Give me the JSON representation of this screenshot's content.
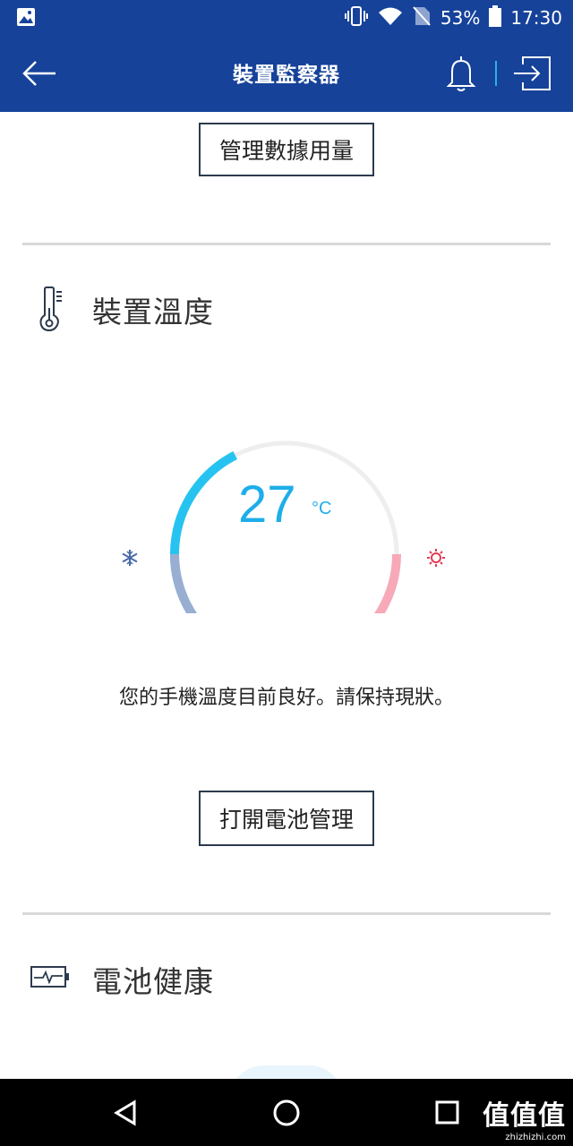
{
  "status_bar": {
    "battery_percent": "53%",
    "time": "17:30",
    "icons": [
      "image-notification-icon",
      "vibrate-icon",
      "wifi-icon",
      "no-sim-icon",
      "battery-icon"
    ]
  },
  "app_bar": {
    "title": "裝置監察器",
    "icons": [
      "back-arrow-icon",
      "bell-icon",
      "exit-icon"
    ]
  },
  "data_section": {
    "manage_button_label": "管理數據用量"
  },
  "temperature_section": {
    "title": "裝置溫度",
    "value": "27",
    "unit": "°C",
    "message": "您的手機溫度目前良好。請保持現狀。",
    "battery_button_label": "打開電池管理",
    "gauge_level_percent": 40,
    "colors": {
      "active": "#27c3f0",
      "track": "#eeeeee",
      "cold": "#9aaed2",
      "hot": "#f7a9b7"
    }
  },
  "battery_section": {
    "title": "電池健康"
  },
  "watermark": {
    "brand": "值值值",
    "domain": "zhizhizhi.com"
  }
}
